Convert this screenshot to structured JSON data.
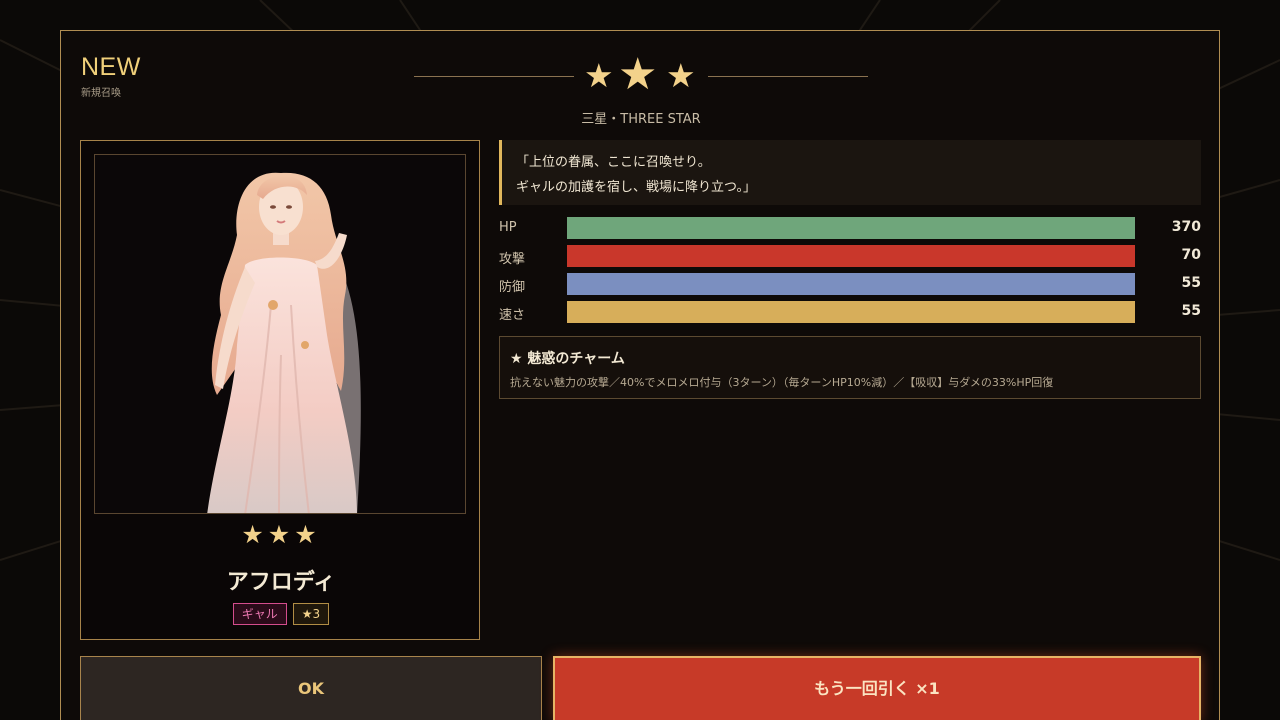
{
  "header": {
    "badge": "NEW",
    "badge_sub": "新規召喚",
    "rarity_stars": [
      "★",
      "★",
      "★"
    ],
    "rarity_caption": "三星・THREE STAR"
  },
  "character": {
    "stars": "★★★",
    "name": "アフロディ",
    "tags": [
      "ギャル",
      "★3"
    ],
    "quote": [
      "「上位の眷属、ここに召喚せり。",
      "ギャルの加護を宿し、戦場に降り立つ。」"
    ],
    "stats": [
      {
        "label": "HP",
        "value": "370",
        "fill": 1.0,
        "color": "#6fa67b"
      },
      {
        "label": "攻撃",
        "value": "70",
        "fill": 1.0,
        "color": "#c9372b"
      },
      {
        "label": "防御",
        "value": "55",
        "fill": 1.0,
        "color": "#7b8fc0"
      },
      {
        "label": "速さ",
        "value": "55",
        "fill": 1.0,
        "color": "#d7ae5a"
      }
    ],
    "skill": {
      "title": "★ 魅惑のチャーム",
      "description": "抗えない魅力の攻撃／40%でメロメロ付与（3ターン）（毎ターンHP10%減）／【吸収】与ダメの33%HP回復"
    }
  },
  "buttons": {
    "ok": "OK",
    "redraw": "もう一回引く ×1"
  },
  "colors": {
    "accent_gold": "#f3d28b",
    "border_gold": "#b08d52",
    "redraw_red": "#c73a28"
  }
}
